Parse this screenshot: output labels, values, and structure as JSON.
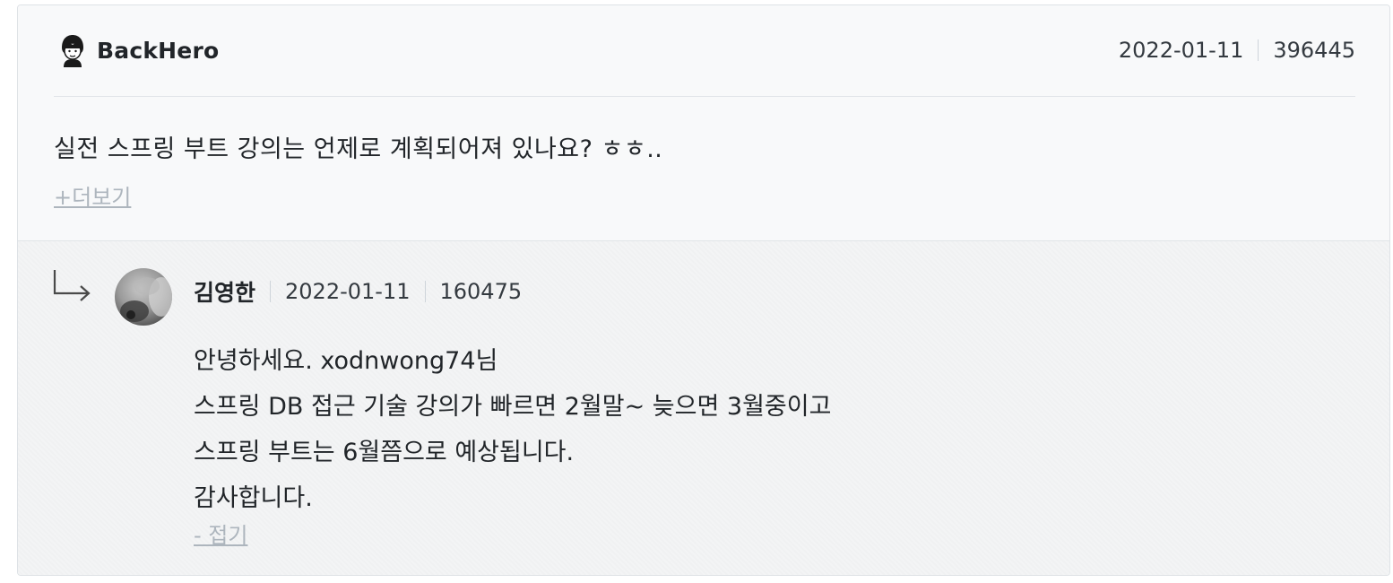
{
  "question": {
    "author": "BackHero",
    "date": "2022-01-11",
    "views": "396445",
    "body": "실전 스프링 부트 강의는 언제로 계획되어져 있나요? ㅎㅎ..",
    "more_label": "+더보기"
  },
  "reply": {
    "author": "김영한",
    "date": "2022-01-11",
    "views": "160475",
    "lines": [
      "안녕하세요. xodnwong74님",
      "스프링 DB 접근 기술 강의가 빠르면 2월말~ 늦으면 3월중이고",
      "스프링 부트는 6월쯤으로 예상됩니다.",
      "감사합니다."
    ],
    "fold_label": "- 접기"
  },
  "icons": {
    "question_avatar": "user-avatar-icon",
    "reply_arrow": "reply-arrow-icon",
    "reply_avatar": "user-photo-avatar"
  },
  "colors": {
    "background": "#f8f9fa",
    "link": "#adb5bd",
    "text": "#212529"
  }
}
